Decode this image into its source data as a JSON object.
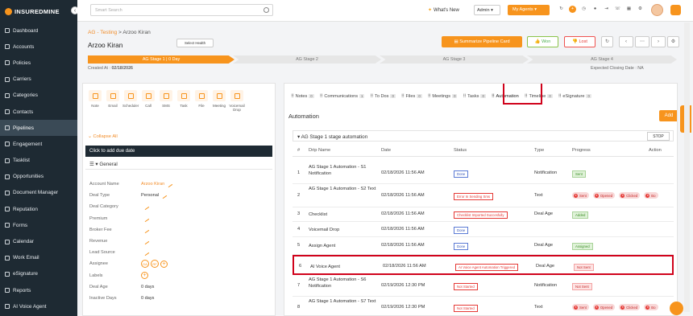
{
  "brand": {
    "name": "INSUREDMINE",
    "accent": "#f7941d",
    "dark": "#1e2a33",
    "highlight": "#d0021b"
  },
  "sidebar": {
    "items": [
      {
        "label": "Dashboard"
      },
      {
        "label": "Accounts"
      },
      {
        "label": "Policies"
      },
      {
        "label": "Carriers"
      },
      {
        "label": "Categories"
      },
      {
        "label": "Contacts"
      },
      {
        "label": "Pipelines"
      },
      {
        "label": "Engagement"
      },
      {
        "label": "Tasklist"
      },
      {
        "label": "Opportunities"
      },
      {
        "label": "Document Manager"
      },
      {
        "label": "Reputation"
      },
      {
        "label": "Forms"
      },
      {
        "label": "Calendar"
      },
      {
        "label": "Work Email"
      },
      {
        "label": "eSignature"
      },
      {
        "label": "Reports"
      },
      {
        "label": "AI Voice Agent"
      }
    ],
    "active_index": 6
  },
  "topbar": {
    "search_placeholder": "Smart Search",
    "whats_new": "What's New",
    "role": "Admin",
    "my_agents": "My Agents"
  },
  "breadcrumb": {
    "parent": "AG - Testing",
    "sep": ">",
    "current": "Arzoo Kiran"
  },
  "deal": {
    "title": "Arzoo Kiran",
    "select_health": "Select Health",
    "summarize": "Summarize Pipeline Card",
    "won": "Won",
    "lost": "Lost",
    "created_label": "Created At :",
    "created_value": "02/18/2026",
    "closing": "Expected Closing Date : NA"
  },
  "stages": [
    {
      "label": "AG Stage 1 | 0 Day",
      "active": true
    },
    {
      "label": "AG Stage 2",
      "active": false
    },
    {
      "label": "AG Stage 3",
      "active": false
    },
    {
      "label": "AG Stage 4",
      "active": false
    }
  ],
  "left": {
    "actions": [
      {
        "label": "Note"
      },
      {
        "label": "Email"
      },
      {
        "label": "Scheduler"
      },
      {
        "label": "Call"
      },
      {
        "label": "SMS"
      },
      {
        "label": "Task"
      },
      {
        "label": "File"
      },
      {
        "label": "Meeting"
      },
      {
        "label": "Voicemail Drop"
      }
    ],
    "collapse_all": "Collapse All",
    "add_due": "Click to add due date",
    "section": "General",
    "fields": [
      {
        "label": "Account Name",
        "value": "Arzoo Kiran"
      },
      {
        "label": "Deal Type",
        "value": "Personal"
      },
      {
        "label": "Deal Category",
        "value": ""
      },
      {
        "label": "Premium",
        "value": ""
      },
      {
        "label": "Broker Fee",
        "value": ""
      },
      {
        "label": "Revenue",
        "value": ""
      },
      {
        "label": "Lead Source",
        "value": ""
      },
      {
        "label": "Assignee",
        "value": ""
      },
      {
        "label": "Labels",
        "value": ""
      },
      {
        "label": "Deal Age",
        "value": "0 days"
      },
      {
        "label": "Inactive Days",
        "value": "0 days"
      }
    ],
    "assignees": [
      "DA",
      "RF"
    ]
  },
  "tabs": [
    {
      "label": "Notes",
      "count": "0"
    },
    {
      "label": "Communications",
      "count": "1"
    },
    {
      "label": "To Dos",
      "count": "0"
    },
    {
      "label": "Files",
      "count": "0"
    },
    {
      "label": "Meetings",
      "count": "0"
    },
    {
      "label": "Tasks",
      "count": "0"
    },
    {
      "label": "Automation",
      "count": ""
    },
    {
      "label": "Timeline",
      "count": "0"
    },
    {
      "label": "eSignature",
      "count": "0"
    }
  ],
  "automation": {
    "title": "Automation",
    "add": "Add",
    "section": "AG Stage 1 stage automation",
    "stop": "STOP",
    "columns": [
      "#",
      "Drip Name",
      "Date",
      "Status",
      "Type",
      "Progress",
      "Action"
    ],
    "rows": [
      {
        "n": "1",
        "name": "AG Stage 1 Automation - S1 Notification",
        "date": "02/18/2026 11:56 AM",
        "status": "Done",
        "status_color": "blue",
        "type": "Notification",
        "progress": "Sent",
        "pills": []
      },
      {
        "n": "2",
        "name": "AG Stage 1 Automation - S2 Text",
        "date": "02/18/2026 11:56 AM",
        "status": "Error In Sending Sms",
        "status_color": "red",
        "type": "Text",
        "progress": "",
        "pills": [
          "Sent",
          "Opened",
          "Clicked",
          "Bo"
        ]
      },
      {
        "n": "3",
        "name": "Checklist",
        "date": "02/18/2026 11:56 AM",
        "status": "Checklist Imported Succesfully",
        "status_color": "red",
        "type": "Deal Age",
        "progress": "Added",
        "pills": []
      },
      {
        "n": "4",
        "name": "Voicemail Drop",
        "date": "02/18/2026 11:56 AM",
        "status": "Done",
        "status_color": "blue",
        "type": "",
        "progress": "",
        "pills": []
      },
      {
        "n": "5",
        "name": "Assign Agent",
        "date": "02/18/2026 11:56 AM",
        "status": "Done",
        "status_color": "blue",
        "type": "Deal Age",
        "progress": "Assigned",
        "pills": []
      },
      {
        "n": "6",
        "name": "AI Voice Agent",
        "date": "02/18/2026 11:56 AM",
        "status": "AI Voice Agent Automation Triggered",
        "status_color": "red",
        "type": "Deal Age",
        "progress": "Not Sent",
        "pills": []
      },
      {
        "n": "7",
        "name": "AG Stage 1 Automation - S6 Notification",
        "date": "02/19/2026 12:30 PM",
        "status": "Not Started",
        "status_color": "red",
        "type": "Notification",
        "progress": "Not Sent",
        "pills": []
      },
      {
        "n": "8",
        "name": "AG Stage 1 Automation - S7 Text",
        "date": "02/19/2026 12:30 PM",
        "status": "Not Started",
        "status_color": "red",
        "type": "Text",
        "progress": "",
        "pills": [
          "Sent",
          "Opened",
          "Clicked",
          "Bo"
        ]
      }
    ]
  },
  "help_label": "Help"
}
